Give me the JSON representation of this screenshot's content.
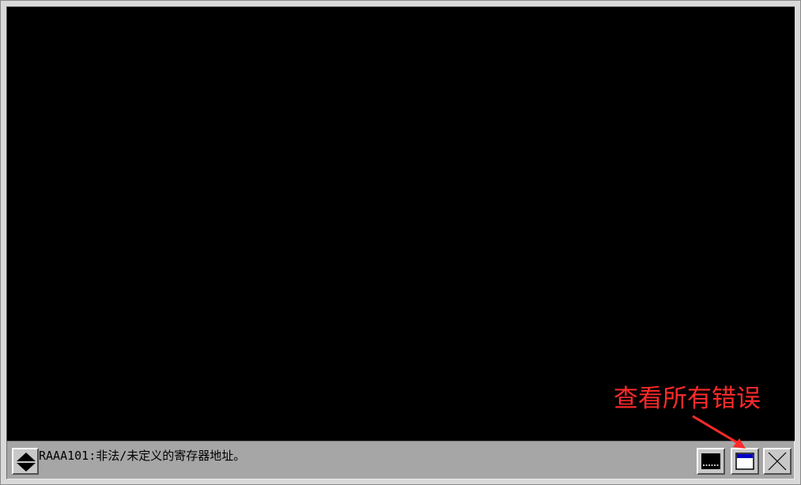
{
  "alarm_bar": {
    "message": "RAAA101:非法/未定义的寄存器地址。",
    "scroll_icon": "up-down-arrow-icon",
    "hide_button_icon": "alarm-window-minimize-icon",
    "all_errors_button_icon": "alarm-window-list-icon",
    "close_button_icon": "close-x-icon"
  },
  "annotation": {
    "label": "查看所有错误",
    "color": "#ff2a2a"
  },
  "colors": {
    "screen_background": "#000000",
    "alarm_bar_background": "#a6a6a6",
    "window_highlight_blue": "#0000c8"
  }
}
